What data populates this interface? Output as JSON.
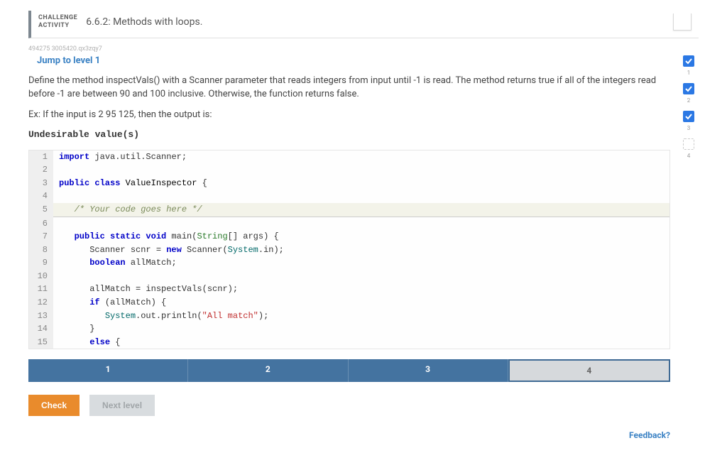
{
  "header": {
    "activity_type_line1": "CHALLENGE",
    "activity_type_line2": "ACTIVITY",
    "title": "6.6.2: Methods with loops."
  },
  "small_id": "494275 3005420.qx3zqy7",
  "jump_link": "Jump to level 1",
  "problem": {
    "p1": "Define the method inspectVals() with a Scanner parameter that reads integers from input until -1 is read. The method returns true if all of the integers read before -1 are between 90 and 100 inclusive. Otherwise, the function returns false.",
    "p2": "Ex: If the input is 2 95 125, then the output is:",
    "output": "Undesirable value(s)"
  },
  "code": [
    {
      "n": "1",
      "pre": "",
      "tokens": [
        {
          "c": "kw",
          "t": "import"
        },
        {
          "c": "",
          "t": " java.util.Scanner;"
        }
      ]
    },
    {
      "n": "2",
      "pre": "",
      "tokens": []
    },
    {
      "n": "3",
      "pre": "",
      "tokens": [
        {
          "c": "kw",
          "t": "public class"
        },
        {
          "c": "",
          "t": " "
        },
        {
          "c": "cls",
          "t": "ValueInspector"
        },
        {
          "c": "",
          "t": " {"
        }
      ]
    },
    {
      "n": "4",
      "pre": "",
      "tokens": []
    },
    {
      "n": "5",
      "hl": true,
      "pre": "   ",
      "tokens": [
        {
          "c": "",
          "t": "/* Your code goes here */"
        }
      ]
    },
    {
      "n": "6",
      "pre": "",
      "tokens": []
    },
    {
      "n": "7",
      "pre": "   ",
      "tokens": [
        {
          "c": "kw",
          "t": "public static void"
        },
        {
          "c": "",
          "t": " main("
        },
        {
          "c": "typ",
          "t": "String"
        },
        {
          "c": "",
          "t": "[] args) {"
        }
      ]
    },
    {
      "n": "8",
      "pre": "      ",
      "tokens": [
        {
          "c": "",
          "t": "Scanner scnr = "
        },
        {
          "c": "kw",
          "t": "new"
        },
        {
          "c": "",
          "t": " Scanner("
        },
        {
          "c": "sys",
          "t": "System"
        },
        {
          "c": "",
          "t": ".in);"
        }
      ]
    },
    {
      "n": "9",
      "pre": "      ",
      "tokens": [
        {
          "c": "kw",
          "t": "boolean"
        },
        {
          "c": "",
          "t": " allMatch;"
        }
      ]
    },
    {
      "n": "10",
      "pre": "",
      "tokens": []
    },
    {
      "n": "11",
      "pre": "      ",
      "tokens": [
        {
          "c": "",
          "t": "allMatch = inspectVals(scnr);"
        }
      ]
    },
    {
      "n": "12",
      "pre": "      ",
      "tokens": [
        {
          "c": "kw",
          "t": "if"
        },
        {
          "c": "",
          "t": " (allMatch) {"
        }
      ]
    },
    {
      "n": "13",
      "pre": "         ",
      "tokens": [
        {
          "c": "sys",
          "t": "System"
        },
        {
          "c": "",
          "t": ".out.println("
        },
        {
          "c": "str",
          "t": "\"All match\""
        },
        {
          "c": "",
          "t": ");"
        }
      ]
    },
    {
      "n": "14",
      "pre": "      ",
      "tokens": [
        {
          "c": "",
          "t": "}"
        }
      ]
    },
    {
      "n": "15",
      "pre": "      ",
      "tokens": [
        {
          "c": "kw",
          "t": "else"
        },
        {
          "c": "",
          "t": " {"
        }
      ]
    }
  ],
  "steps": [
    "1",
    "2",
    "3",
    "4"
  ],
  "current_step": "4",
  "buttons": {
    "check": "Check",
    "next": "Next level"
  },
  "feedback": "Feedback?",
  "side_checks": [
    {
      "done": true,
      "n": "1"
    },
    {
      "done": true,
      "n": "2"
    },
    {
      "done": true,
      "n": "3"
    },
    {
      "done": false,
      "n": "4"
    }
  ]
}
